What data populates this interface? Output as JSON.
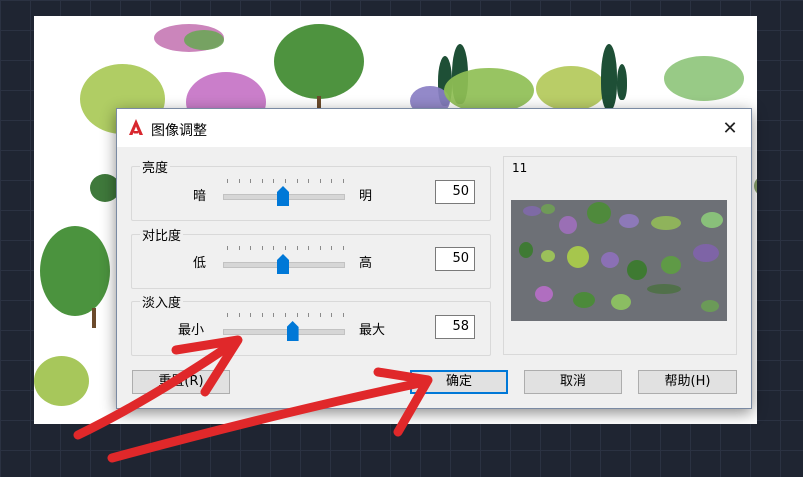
{
  "dialog": {
    "title": "图像调整",
    "close_glyph": "✕"
  },
  "brightness": {
    "group": "亮度",
    "min_label": "暗",
    "max_label": "明",
    "value": "50",
    "level": 0.5
  },
  "contrast": {
    "group": "对比度",
    "min_label": "低",
    "max_label": "高",
    "value": "50",
    "level": 0.5
  },
  "fade": {
    "group": "淡入度",
    "min_label": "最小",
    "max_label": "最大",
    "value": "58",
    "level": 0.58
  },
  "preview": {
    "label": "11"
  },
  "buttons": {
    "reset": "重置(R)",
    "ok": "确定",
    "cancel": "取消",
    "help": "帮助(H)"
  },
  "colors": {
    "accent": "#0078d7",
    "annotation": "#e0282a"
  }
}
